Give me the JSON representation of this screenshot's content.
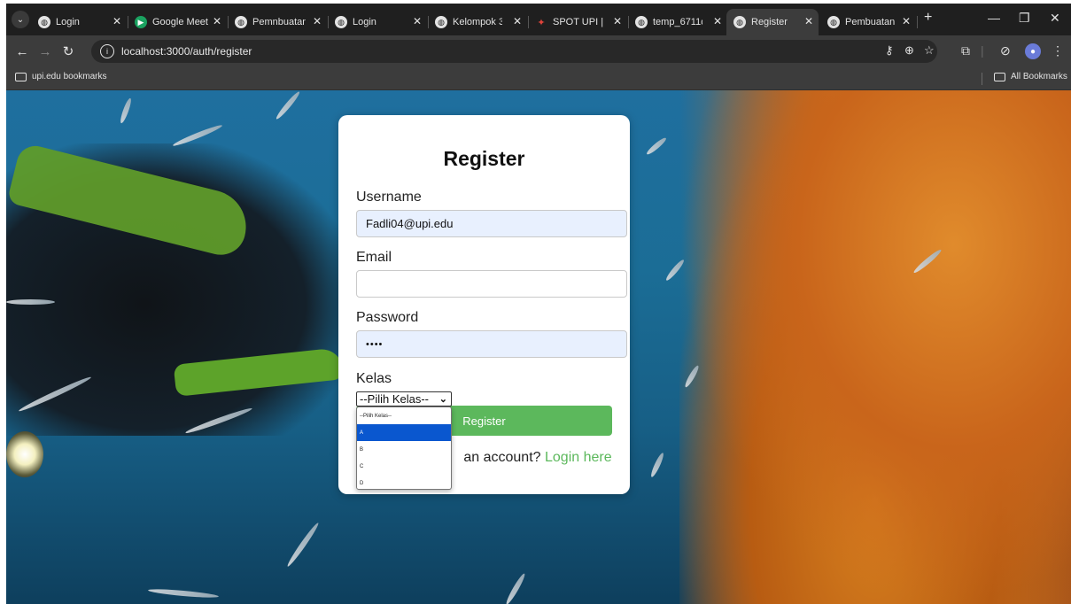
{
  "browser": {
    "tabs": [
      {
        "title": "Login",
        "active": false
      },
      {
        "title": "Google Meet",
        "active": false
      },
      {
        "title": "Pemnbuatan",
        "active": false
      },
      {
        "title": "Login",
        "active": false
      },
      {
        "title": "Kelompok 3_",
        "active": false
      },
      {
        "title": "SPOT UPI | M",
        "active": false
      },
      {
        "title": "temp_6711di",
        "active": false
      },
      {
        "title": "Register",
        "active": true
      },
      {
        "title": "Pembuatan",
        "active": false
      }
    ],
    "url": "localhost:3000/auth/register",
    "bookmarks": {
      "left": "upi.edu bookmarks",
      "right": "All Bookmarks"
    }
  },
  "register": {
    "title": "Register",
    "username_label": "Username",
    "username_value": "Fadli04@upi.edu",
    "email_label": "Email",
    "email_value": "",
    "password_label": "Password",
    "password_value": "••••",
    "kelas_label": "Kelas",
    "kelas_selected": "--Pilih Kelas--",
    "kelas_options": [
      "--Pilih Kelas--",
      "A",
      "B",
      "C",
      "D"
    ],
    "kelas_highlighted": "A",
    "submit_label": "Register",
    "login_prompt": "an account?",
    "login_link": "Login here"
  },
  "colors": {
    "accent": "#5cb85c",
    "option_highlight": "#0a57cf",
    "autofill_bg": "#e8f0fe"
  }
}
